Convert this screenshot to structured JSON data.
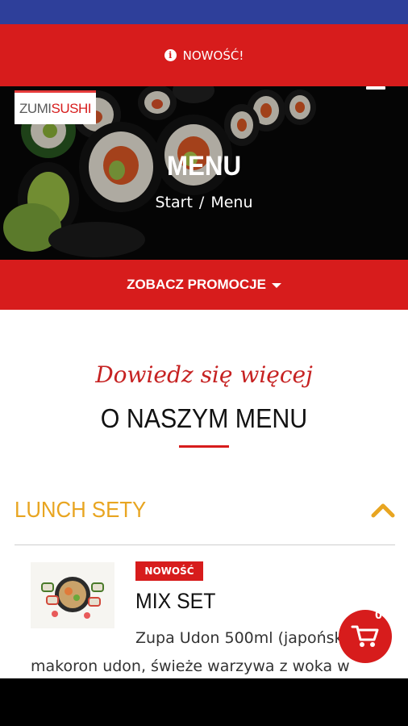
{
  "colors": {
    "status_bar": "#2e3f9a",
    "brand_red": "#d71c1c",
    "accent_gold": "#e8a521"
  },
  "news_bar": {
    "label": "NOWOŚĆ!",
    "icon": "info-icon"
  },
  "header": {
    "logo_part1": "ZUMI",
    "logo_part2": "SUSHI",
    "menu_icon": "hamburger-icon"
  },
  "hero": {
    "title": "MENU",
    "breadcrumb": [
      "Start",
      "/",
      "Menu"
    ]
  },
  "promo": {
    "label": "ZOBACZ PROMOCJE",
    "icon": "caret-down-icon"
  },
  "intro": {
    "script": "Dowiedz się więcej",
    "title": "O NASZYM MENU"
  },
  "category": {
    "label": "LUNCH SETY",
    "icon": "chevron-up-icon"
  },
  "product": {
    "badge": "NOWOŚĆ",
    "title": "MIX SET",
    "description_line1": "Zupa Udon 500ml (japoński",
    "description_line2": "makoron udon, świeże warzywa z woka w"
  },
  "cart": {
    "count": "0",
    "icon": "cart-icon"
  }
}
